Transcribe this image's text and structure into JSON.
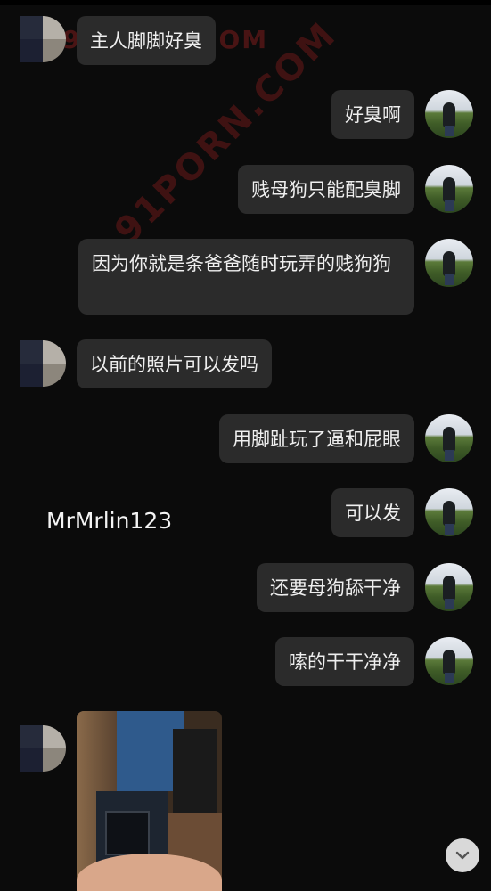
{
  "username_overlay": "MrMrlin123",
  "watermark_top": "91PORN.COM",
  "watermark_diag": "91PORN.COM",
  "messages": [
    {
      "side": "left",
      "text": "主人脚脚好臭"
    },
    {
      "side": "right",
      "text": "好臭啊"
    },
    {
      "side": "right",
      "text": "贱母狗只能配臭脚"
    },
    {
      "side": "right",
      "text": "因为你就是条爸爸随时玩弄的贱狗狗"
    },
    {
      "side": "left",
      "text": "以前的照片可以发吗"
    },
    {
      "side": "right",
      "text": "用脚趾玩了逼和屁眼"
    },
    {
      "side": "right",
      "text": "可以发"
    },
    {
      "side": "right",
      "text": "还要母狗舔干净"
    },
    {
      "side": "right",
      "text": "嗦的干干净净"
    }
  ],
  "icons": {
    "scroll_down": "chevron-down-icon"
  },
  "colors": {
    "background": "#0b0b0b",
    "bubble": "#2b2b2b"
  }
}
